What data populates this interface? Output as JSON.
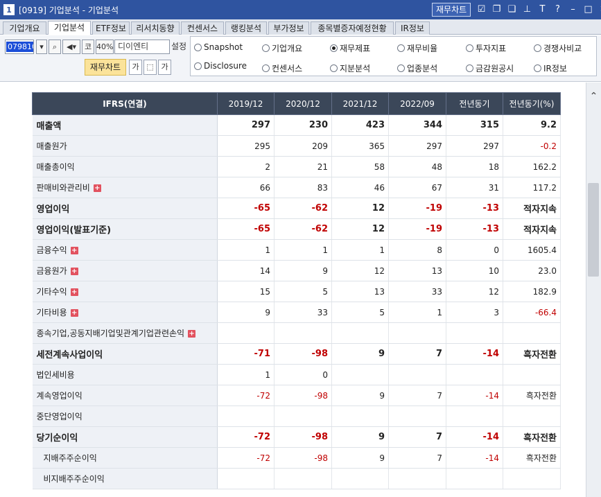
{
  "window": {
    "number": "1",
    "title": "[0919] 기업분석 - 기업분석",
    "chart_button": "재무차트"
  },
  "tabs": [
    {
      "label": "기업개요",
      "active": false
    },
    {
      "label": "기업분석",
      "active": true
    },
    {
      "label": "ETF정보",
      "active": false
    },
    {
      "label": "리서치동향",
      "active": false
    },
    {
      "label": "컨센서스",
      "active": false
    },
    {
      "label": "랭킹분석",
      "active": false
    },
    {
      "label": "부가정보",
      "active": false
    },
    {
      "label": "종목별증자예정현황",
      "active": false
    },
    {
      "label": "IR정보",
      "active": false
    }
  ],
  "controls": {
    "code": "079810",
    "market": "코",
    "percent": "40%",
    "company": "디이엔티",
    "setting_label": "설정",
    "fin_chart_button": "재무차트",
    "font_button": "가"
  },
  "radios": [
    {
      "label": "Snapshot",
      "checked": false
    },
    {
      "label": "기업개요",
      "checked": false
    },
    {
      "label": "재무제표",
      "checked": true
    },
    {
      "label": "재무비율",
      "checked": false
    },
    {
      "label": "투자지표",
      "checked": false
    },
    {
      "label": "경쟁사비교",
      "checked": false
    },
    {
      "label": "Disclosure",
      "checked": false
    },
    {
      "label": "컨센서스",
      "checked": false
    },
    {
      "label": "지분분석",
      "checked": false
    },
    {
      "label": "업종분석",
      "checked": false
    },
    {
      "label": "금감원공시",
      "checked": false
    },
    {
      "label": "IR정보",
      "checked": false
    }
  ],
  "table": {
    "headers": [
      "IFRS(연결)",
      "2019/12",
      "2020/12",
      "2021/12",
      "2022/09",
      "전년동기",
      "전년동기(%)"
    ],
    "rows": [
      {
        "label": "매출액",
        "values": [
          "297",
          "230",
          "423",
          "344",
          "315",
          "9.2"
        ],
        "bold": true,
        "major": false,
        "indent": false,
        "expand": false
      },
      {
        "label": "매출원가",
        "values": [
          "295",
          "209",
          "365",
          "297",
          "297",
          "-0.2"
        ],
        "bold": false,
        "major": false,
        "indent": false,
        "expand": false
      },
      {
        "label": "매출총이익",
        "values": [
          "2",
          "21",
          "58",
          "48",
          "18",
          "162.2"
        ],
        "bold": false,
        "major": false,
        "indent": false,
        "expand": false
      },
      {
        "label": "판매비와관리비",
        "values": [
          "66",
          "83",
          "46",
          "67",
          "31",
          "117.2"
        ],
        "bold": false,
        "major": false,
        "indent": false,
        "expand": true
      },
      {
        "label": "영업이익",
        "values": [
          "-65",
          "-62",
          "12",
          "-19",
          "-13",
          "적자지속"
        ],
        "bold": true,
        "major": true,
        "indent": false,
        "expand": false
      },
      {
        "label": "영업이익(발표기준)",
        "values": [
          "-65",
          "-62",
          "12",
          "-19",
          "-13",
          "적자지속"
        ],
        "bold": true,
        "major": false,
        "indent": false,
        "expand": false
      },
      {
        "label": "금융수익",
        "values": [
          "1",
          "1",
          "1",
          "8",
          "0",
          "1605.4"
        ],
        "bold": false,
        "major": false,
        "indent": false,
        "expand": true
      },
      {
        "label": "금융원가",
        "values": [
          "14",
          "9",
          "12",
          "13",
          "10",
          "23.0"
        ],
        "bold": false,
        "major": false,
        "indent": false,
        "expand": true
      },
      {
        "label": "기타수익",
        "values": [
          "15",
          "5",
          "13",
          "33",
          "12",
          "182.9"
        ],
        "bold": false,
        "major": false,
        "indent": false,
        "expand": true
      },
      {
        "label": "기타비용",
        "values": [
          "9",
          "33",
          "5",
          "1",
          "3",
          "-66.4"
        ],
        "bold": false,
        "major": false,
        "indent": false,
        "expand": true
      },
      {
        "label": "종속기업,공동지배기업및관계기업관련손익",
        "values": [
          "",
          "",
          "",
          "",
          "",
          ""
        ],
        "bold": false,
        "major": false,
        "indent": false,
        "expand": true
      },
      {
        "label": "세전계속사업이익",
        "values": [
          "-71",
          "-98",
          "9",
          "7",
          "-14",
          "흑자전환"
        ],
        "bold": true,
        "major": true,
        "indent": false,
        "expand": false
      },
      {
        "label": "법인세비용",
        "values": [
          "1",
          "0",
          "",
          "",
          "",
          ""
        ],
        "bold": false,
        "major": false,
        "indent": false,
        "expand": false
      },
      {
        "label": "계속영업이익",
        "values": [
          "-72",
          "-98",
          "9",
          "7",
          "-14",
          "흑자전환"
        ],
        "bold": false,
        "major": false,
        "indent": false,
        "expand": false
      },
      {
        "label": "중단영업이익",
        "values": [
          "",
          "",
          "",
          "",
          "",
          ""
        ],
        "bold": false,
        "major": false,
        "indent": false,
        "expand": false
      },
      {
        "label": "당기순이익",
        "values": [
          "-72",
          "-98",
          "9",
          "7",
          "-14",
          "흑자전환"
        ],
        "bold": true,
        "major": true,
        "indent": false,
        "expand": false
      },
      {
        "label": "지배주주순이익",
        "values": [
          "-72",
          "-98",
          "9",
          "7",
          "-14",
          "흑자전환"
        ],
        "bold": false,
        "major": false,
        "indent": true,
        "expand": false
      },
      {
        "label": "비지배주주순이익",
        "values": [
          "",
          "",
          "",
          "",
          "",
          ""
        ],
        "bold": false,
        "major": false,
        "indent": true,
        "expand": false
      }
    ]
  }
}
